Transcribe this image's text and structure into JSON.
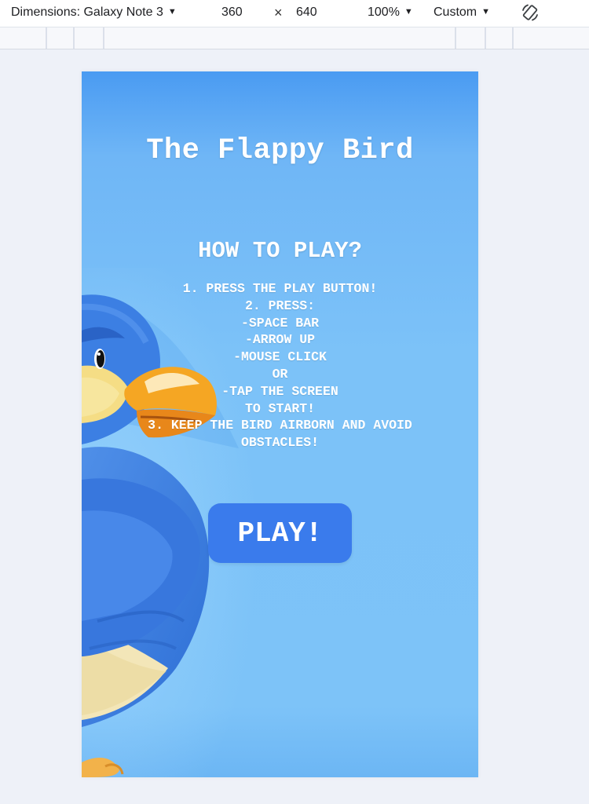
{
  "devtools": {
    "dimensions_label": "Dimensions: Galaxy Note 3",
    "width": "360",
    "times": "×",
    "height": "640",
    "zoom": "100%",
    "throttle": "Custom"
  },
  "game": {
    "title": "The Flappy Bird",
    "how_to_play_heading": "HOW TO PLAY?",
    "instructions": [
      "1. PRESS THE PLAY BUTTON!",
      "2. PRESS:",
      "-SPACE BAR",
      "-ARROW UP",
      "-MOUSE CLICK",
      "OR",
      "-TAP THE SCREEN",
      "TO START!",
      "3. KEEP THE BIRD AIRBORN AND AVOID",
      "OBSTACLES!"
    ],
    "play_label": "PLAY!"
  },
  "colors": {
    "sky": "#7cc2f8",
    "play_button": "#3a7bec",
    "bird_body": "#3b7fe0",
    "beak": "#f5a623"
  }
}
